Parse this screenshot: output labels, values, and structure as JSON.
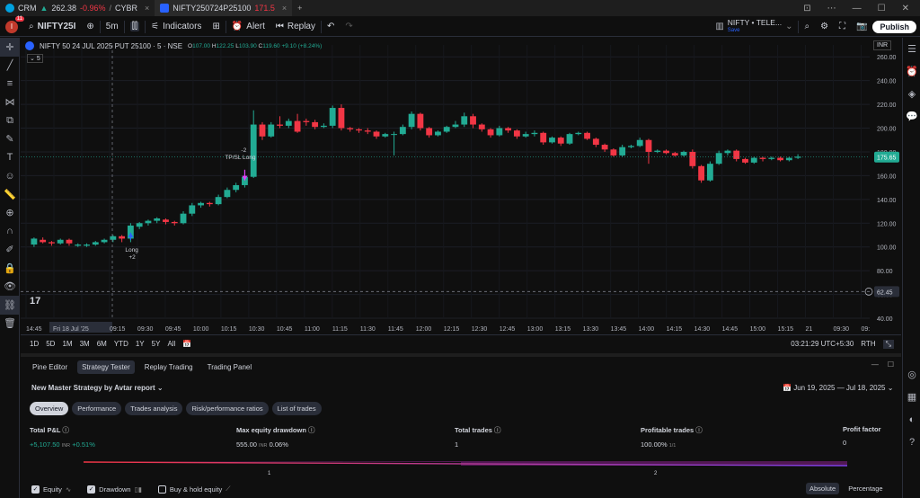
{
  "tabs": [
    {
      "name": "CRM",
      "price": "262.38",
      "change": "-0.96%",
      "extra": "CYBR",
      "color": "#00a1e0",
      "active": false
    },
    {
      "name": "NIFTY250724P25100",
      "price": "171.5",
      "change": "",
      "extra": "",
      "color": "#2962ff",
      "active": true
    }
  ],
  "toolbar": {
    "avatar_letter": "I",
    "notif_count": "11",
    "symbol": "NIFTY25I",
    "interval": "5m",
    "indicators": "Indicators",
    "alert": "Alert",
    "replay": "Replay",
    "layout_name": "NIFTY • TELE...",
    "layout_sub": "Save",
    "publish": "Publish"
  },
  "legend": {
    "title": "NIFTY 50 24 JUL 2025 PUT 25100 · 5 · NSE",
    "o": "107.00",
    "h": "122.25",
    "l": "103.90",
    "c": "119.60",
    "chg": "+9.10 (+8.24%)",
    "interval_box": "5",
    "currency": "INR"
  },
  "chart_data": {
    "type": "candlestick",
    "symbol": "NIFTY 50 24 JUL 2025 PUT 25100",
    "exchange": "NSE",
    "interval": "5",
    "ylim": [
      40,
      270
    ],
    "yticks": [
      40,
      60,
      80,
      100,
      120,
      140,
      160,
      180,
      200,
      220,
      240,
      260
    ],
    "xticks": [
      "14:45",
      "15:00",
      "Fri 18 Jul '25",
      "09:15",
      "09:30",
      "09:45",
      "10:00",
      "10:15",
      "10:30",
      "10:45",
      "11:00",
      "11:15",
      "11:30",
      "11:45",
      "12:00",
      "12:15",
      "12:30",
      "12:45",
      "13:00",
      "13:15",
      "13:30",
      "13:45",
      "14:00",
      "14:15",
      "14:30",
      "14:45",
      "15:00",
      "15:15",
      "21",
      "09:30",
      "09:"
    ],
    "last_price": "175.65",
    "crosshair_price": "62.45",
    "candles": [
      [
        102,
        107,
        100,
        108
      ],
      [
        106,
        104,
        103,
        108
      ],
      [
        104,
        103,
        101,
        105
      ],
      [
        103,
        106,
        102,
        107
      ],
      [
        106,
        103,
        101,
        107
      ],
      [
        101,
        102,
        100,
        103
      ],
      [
        101,
        102,
        100,
        103
      ],
      [
        102,
        104,
        101,
        105
      ],
      [
        104,
        106,
        103,
        107
      ],
      [
        106,
        109,
        104,
        110
      ],
      [
        109,
        107,
        104,
        110
      ],
      [
        107,
        118,
        104,
        120
      ],
      [
        117,
        120,
        115,
        121
      ],
      [
        120,
        122,
        118,
        123
      ],
      [
        122,
        124,
        120,
        125
      ],
      [
        123,
        121,
        119,
        124
      ],
      [
        121,
        120,
        118,
        122
      ],
      [
        120,
        128,
        119,
        130
      ],
      [
        128,
        135,
        126,
        137
      ],
      [
        135,
        137,
        133,
        138
      ],
      [
        137,
        136,
        134,
        138
      ],
      [
        136,
        142,
        135,
        144
      ],
      [
        142,
        148,
        141,
        150
      ],
      [
        148,
        152,
        146,
        154
      ],
      [
        152,
        159,
        150,
        161
      ],
      [
        159,
        203,
        158,
        215
      ],
      [
        203,
        193,
        190,
        205
      ],
      [
        193,
        203,
        192,
        205
      ],
      [
        203,
        202,
        200,
        210
      ],
      [
        202,
        206,
        200,
        208
      ],
      [
        206,
        197,
        196,
        212
      ],
      [
        206,
        205,
        202,
        208
      ],
      [
        205,
        201,
        199,
        207
      ],
      [
        201,
        202,
        200,
        204
      ],
      [
        202,
        217,
        200,
        219
      ],
      [
        217,
        200,
        198,
        220
      ],
      [
        200,
        199,
        197,
        201
      ],
      [
        199,
        198,
        196,
        200
      ],
      [
        198,
        197,
        195,
        200
      ],
      [
        197,
        193,
        191,
        198
      ],
      [
        193,
        195,
        192,
        196
      ],
      [
        195,
        195,
        177,
        197
      ],
      [
        195,
        201,
        194,
        203
      ],
      [
        201,
        212,
        199,
        214
      ],
      [
        212,
        200,
        198,
        213
      ],
      [
        200,
        194,
        192,
        201
      ],
      [
        194,
        197,
        193,
        198
      ],
      [
        197,
        201,
        196,
        202
      ],
      [
        201,
        203,
        200,
        206
      ],
      [
        203,
        210,
        201,
        213
      ],
      [
        210,
        203,
        200,
        212
      ],
      [
        203,
        199,
        197,
        204
      ],
      [
        199,
        194,
        192,
        200
      ],
      [
        194,
        200,
        193,
        202
      ],
      [
        200,
        198,
        196,
        201
      ],
      [
        198,
        193,
        191,
        199
      ],
      [
        193,
        195,
        192,
        197
      ],
      [
        195,
        196,
        193,
        198
      ],
      [
        196,
        188,
        186,
        197
      ],
      [
        188,
        192,
        187,
        193
      ],
      [
        192,
        187,
        185,
        193
      ],
      [
        187,
        195,
        186,
        196
      ],
      [
        195,
        196,
        194,
        197
      ],
      [
        196,
        191,
        190,
        197
      ],
      [
        191,
        186,
        184,
        192
      ],
      [
        186,
        182,
        180,
        187
      ],
      [
        182,
        177,
        176,
        183
      ],
      [
        177,
        184,
        176,
        186
      ],
      [
        184,
        185,
        183,
        186
      ],
      [
        185,
        190,
        184,
        192
      ],
      [
        190,
        180,
        170,
        191
      ],
      [
        180,
        181,
        179,
        182
      ],
      [
        181,
        179,
        178,
        182
      ],
      [
        179,
        177,
        176,
        180
      ],
      [
        177,
        180,
        176,
        181
      ],
      [
        180,
        168,
        166,
        182
      ],
      [
        168,
        156,
        154,
        169
      ],
      [
        156,
        170,
        155,
        172
      ],
      [
        170,
        179,
        169,
        181
      ],
      [
        179,
        181,
        177,
        182
      ],
      [
        181,
        174,
        172,
        182
      ],
      [
        174,
        171,
        170,
        175
      ],
      [
        171,
        175,
        170,
        176
      ],
      [
        175,
        174,
        172,
        176
      ],
      [
        174,
        175,
        173,
        176
      ],
      [
        175,
        173,
        172,
        176
      ],
      [
        173,
        175,
        172,
        176
      ],
      [
        175,
        176,
        174,
        178
      ]
    ],
    "markers": [
      {
        "label": "Long",
        "qty": "+2",
        "kind": "entry"
      },
      {
        "label": "TP/SL Long",
        "qty": "-2",
        "kind": "exit"
      }
    ]
  },
  "rangebar": {
    "ranges": [
      "1D",
      "5D",
      "1M",
      "3M",
      "6M",
      "YTD",
      "1Y",
      "5Y",
      "All"
    ],
    "time": "03:21:29 UTC+5:30",
    "session": "RTH"
  },
  "bottom": {
    "tabs": [
      "Pine Editor",
      "Strategy Tester",
      "Replay Trading",
      "Trading Panel"
    ],
    "strategy_name": "New Master Strategy by Avtar report",
    "date_range": "Jun 19, 2025 — Jul 18, 2025",
    "pills": [
      "Overview",
      "Performance",
      "Trades analysis",
      "Risk/performance ratios",
      "List of trades"
    ],
    "stats": [
      {
        "label": "Total P&L",
        "value": "+5,107.50",
        "unit": "INR",
        "pct": "+0.51%",
        "positive": true
      },
      {
        "label": "Max equity drawdown",
        "value": "555.00",
        "unit": "INR",
        "pct": "0.06%",
        "positive": false
      },
      {
        "label": "Total trades",
        "value": "1",
        "unit": "",
        "pct": "",
        "positive": false
      },
      {
        "label": "Profitable trades",
        "value": "100.00%",
        "unit": "",
        "pct": "1/1",
        "positive": false
      },
      {
        "label": "Profit factor",
        "value": "0",
        "unit": "",
        "pct": "",
        "positive": false
      }
    ],
    "equity_axis": [
      "1",
      "2"
    ],
    "checkboxes": [
      {
        "label": "Equity",
        "checked": true
      },
      {
        "label": "Drawdown",
        "checked": true
      },
      {
        "label": "Buy & hold equity",
        "checked": false
      }
    ],
    "modes": [
      "Absolute",
      "Percentage"
    ]
  }
}
